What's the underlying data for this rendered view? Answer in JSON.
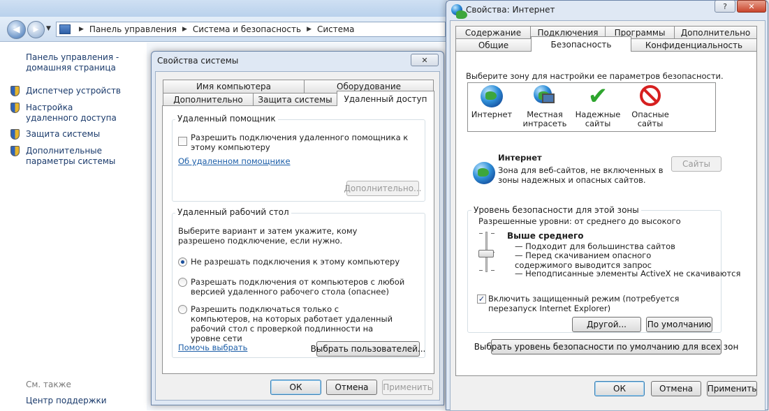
{
  "explorer": {
    "breadcrumb": [
      "Панель управления",
      "Система и безопасность",
      "Система"
    ],
    "sidebar": {
      "home": "Панель управления - домашняя страница",
      "links": [
        "Диспетчер устройств",
        "Настройка удаленного доступа",
        "Защита системы",
        "Дополнительные параметры системы"
      ],
      "see_also": "См. также",
      "support": "Центр поддержки"
    }
  },
  "sys_props": {
    "title": "Свойства системы",
    "close": "✕",
    "tabs_row1": [
      "Имя компьютера",
      "Оборудование"
    ],
    "tabs_row2": [
      "Дополнительно",
      "Защита системы",
      "Удаленный доступ"
    ],
    "remote_assist": {
      "label": "Удаленный помощник",
      "checkbox": "Разрешить подключения удаленного помощника к этому компьютеру",
      "link": "Об удаленном помощнике",
      "advanced": "Дополнительно..."
    },
    "remote_desktop": {
      "label": "Удаленный рабочий стол",
      "intro": "Выберите вариант и затем укажите, кому разрешено подключение, если нужно.",
      "options": [
        "Не разрешать подключения к этому компьютеру",
        "Разрешать подключения от компьютеров с любой версией удаленного рабочего стола (опаснее)",
        "Разрешить подключаться только с компьютеров, на которых работает удаленный рабочий стол с проверкой подлинности на уровне сети"
      ],
      "selected_index": 0,
      "help_link": "Помочь выбрать",
      "select_users": "Выбрать пользователей..."
    },
    "buttons": {
      "ok": "ОК",
      "cancel": "Отмена",
      "apply": "Применить"
    }
  },
  "inet_props": {
    "title": "Свойства: Интернет",
    "help": "?",
    "close": "✕",
    "tabs_row1": [
      "Содержание",
      "Подключения",
      "Программы",
      "Дополнительно"
    ],
    "tabs_row2": [
      "Общие",
      "Безопасность",
      "Конфиденциальность"
    ],
    "zone_prompt": "Выберите зону для настройки ее параметров безопасности.",
    "zones": [
      {
        "label": "Интернет",
        "icon": "internet-globe-icon"
      },
      {
        "label": "Местная интрасеть",
        "icon": "intranet-icon"
      },
      {
        "label": "Надежные сайты",
        "icon": "trusted-check-icon"
      },
      {
        "label": "Опасные сайты",
        "icon": "restricted-icon"
      }
    ],
    "zone_info": {
      "name": "Интернет",
      "desc": "Зона для веб-сайтов, не включенных в зоны надежных и опасных сайтов.",
      "sites_button": "Сайты"
    },
    "security_level": {
      "label": "Уровень безопасности для этой зоны",
      "allowed": "Разрешенные уровни: от среднего до высокого",
      "level_name": "Выше среднего",
      "bullets": [
        "— Подходит для большинства сайтов",
        "— Перед скачиванием опасного содержимого выводится запрос",
        "— Неподписанные элементы ActiveX не скачиваются"
      ],
      "protected_mode": "Включить защищенный режим (потребуется перезапуск Internet Explorer)",
      "custom": "Другой...",
      "default": "По умолчанию"
    },
    "reset_all": "Выбрать уровень безопасности по умолчанию для всех зон",
    "buttons": {
      "ok": "ОК",
      "cancel": "Отмена",
      "apply": "Применить"
    }
  },
  "colors": {
    "accent": "#1c5ea8",
    "dialog_frame": "#dfe8f4"
  }
}
